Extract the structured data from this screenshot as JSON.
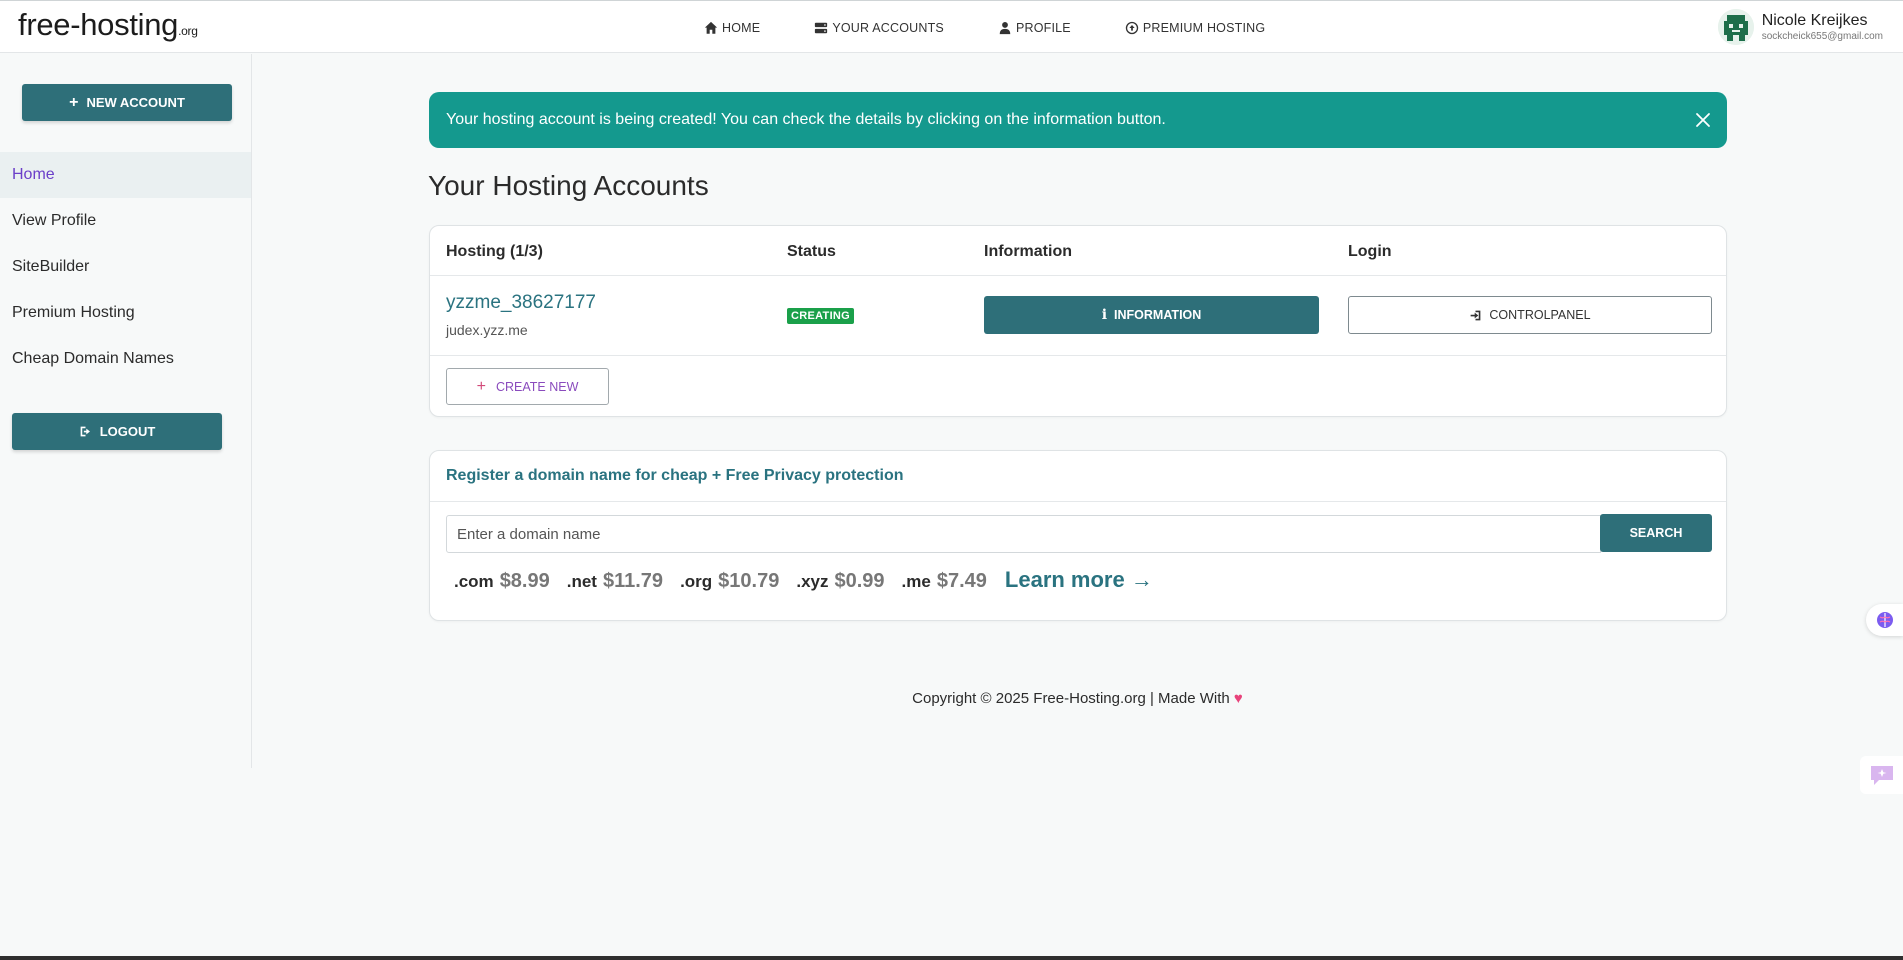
{
  "brand": {
    "name": "free-hosting",
    "tld": ".org"
  },
  "nav": [
    {
      "label": "HOME",
      "icon": "home-icon"
    },
    {
      "label": "YOUR ACCOUNTS",
      "icon": "server-icon"
    },
    {
      "label": "PROFILE",
      "icon": "user-icon"
    },
    {
      "label": "PREMIUM HOSTING",
      "icon": "arrow-circle-icon"
    }
  ],
  "user": {
    "name": "Nicole Kreijkes",
    "email": "sockcheick655@gmail.com"
  },
  "sidebar": {
    "new_account_label": "NEW ACCOUNT",
    "items": [
      {
        "label": "Home",
        "active": true
      },
      {
        "label": "View Profile"
      },
      {
        "label": "SiteBuilder"
      },
      {
        "label": "Premium Hosting"
      },
      {
        "label": "Cheap Domain Names"
      }
    ],
    "logout_label": "LOGOUT"
  },
  "alert": {
    "message": "Your hosting account is being created! You can check the details by clicking on the information button."
  },
  "accounts": {
    "title": "Your Hosting Accounts",
    "headers": {
      "hosting": "Hosting (1/3)",
      "status": "Status",
      "information": "Information",
      "login": "Login"
    },
    "rows": [
      {
        "name": "yzzme_38627177",
        "domain": "judex.yzz.me",
        "status": "CREATING",
        "info_label": "INFORMATION",
        "cp_label": "CONTROLPANEL"
      }
    ],
    "create_new_label": "CREATE NEW"
  },
  "domain": {
    "title": "Register a domain name for cheap + Free Privacy protection",
    "placeholder": "Enter a domain name",
    "search_label": "SEARCH",
    "prices": [
      {
        "tld": ".com",
        "price": "$8.99"
      },
      {
        "tld": ".net",
        "price": "$11.79"
      },
      {
        "tld": ".org",
        "price": "$10.79"
      },
      {
        "tld": ".xyz",
        "price": "$0.99"
      },
      {
        "tld": ".me",
        "price": "$7.49"
      }
    ],
    "learn_more": "Learn more →"
  },
  "footer": {
    "text": "Copyright © 2025 Free-Hosting.org | Made With",
    "heart": "♥"
  },
  "colors": {
    "primary": "#2e6f79",
    "alert": "#14998e",
    "badge": "#1aa04a",
    "accent_link": "#2a7380",
    "active_nav": "#6b3fc9"
  }
}
